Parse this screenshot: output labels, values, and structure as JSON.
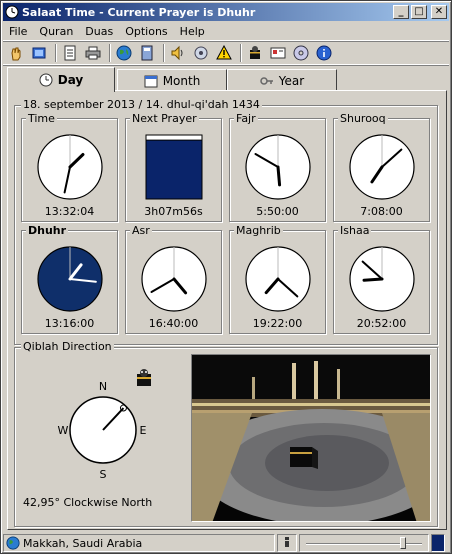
{
  "window": {
    "title": "Salaat Time - Current Prayer is Dhuhr",
    "minimize": "_",
    "maximize": "□",
    "close": "✕"
  },
  "menu": [
    "File",
    "Quran",
    "Duas",
    "Options",
    "Help"
  ],
  "toolbar_icons": [
    "hand-icon",
    "open-icon",
    "notes-icon",
    "print-icon",
    "globe-icon",
    "calculator-icon",
    "speaker-icon",
    "settings-icon",
    "warning-icon",
    "kaaba-icon",
    "card-icon",
    "disc-icon",
    "info-icon"
  ],
  "tabs": [
    {
      "label": "Day",
      "icon": "clock-icon",
      "active": true
    },
    {
      "label": "Month",
      "icon": "calendar-icon",
      "active": false
    },
    {
      "label": "Year",
      "icon": "key-icon",
      "active": false
    }
  ],
  "date_header": "18. september 2013 / 14. dhul-qi'dah 1434",
  "clocks": [
    {
      "label": "Time",
      "value": "13:32:04",
      "hour": 13,
      "minute": 32,
      "bold": false
    },
    {
      "label": "Next Prayer",
      "value": "3h07m56s",
      "progress": 0.92,
      "bold": false
    },
    {
      "label": "Fajr",
      "value": "5:50:00",
      "hour": 5,
      "minute": 50,
      "bold": false
    },
    {
      "label": "Shurooq",
      "value": "7:08:00",
      "hour": 7,
      "minute": 8,
      "bold": false
    },
    {
      "label": "Dhuhr",
      "value": "13:16:00",
      "hour": 13,
      "minute": 16,
      "bold": true,
      "active": true
    },
    {
      "label": "Asr",
      "value": "16:40:00",
      "hour": 16,
      "minute": 40,
      "bold": false
    },
    {
      "label": "Maghrib",
      "value": "19:22:00",
      "hour": 19,
      "minute": 22,
      "bold": false
    },
    {
      "label": "Ishaa",
      "value": "20:52:00",
      "hour": 20,
      "minute": 52,
      "bold": false
    }
  ],
  "qiblah": {
    "title": "Qiblah Direction",
    "north": "N",
    "south": "S",
    "east": "E",
    "west": "W",
    "angle_deg": 42.95,
    "text": "42,95° Clockwise North"
  },
  "status": {
    "location": "Makkah, Saudi Arabia"
  },
  "colors": {
    "navy": "#0a246a",
    "face_active": "#0f2f6a",
    "face": "#ffffff"
  }
}
